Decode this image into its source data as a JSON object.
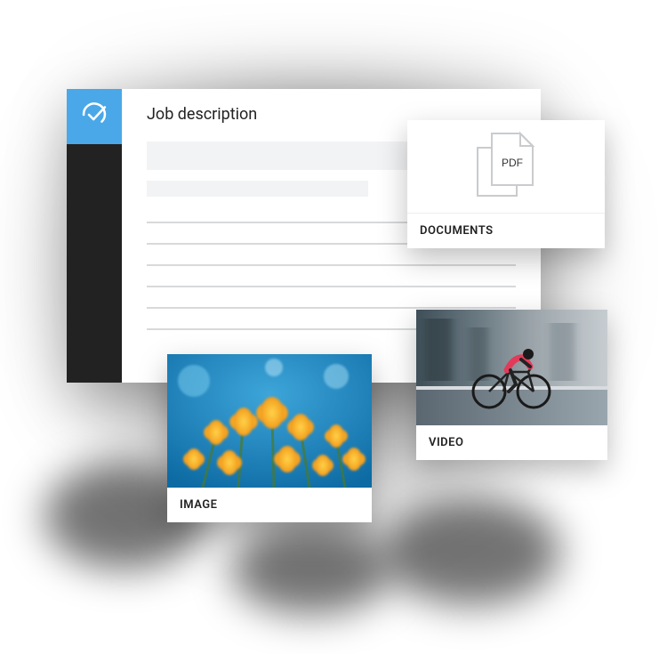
{
  "editor": {
    "title": "Job description"
  },
  "cards": {
    "documents": {
      "label": "DOCUMENTS",
      "file_type": "PDF"
    },
    "image": {
      "label": "IMAGE"
    },
    "video": {
      "label": "VIDEO"
    }
  }
}
